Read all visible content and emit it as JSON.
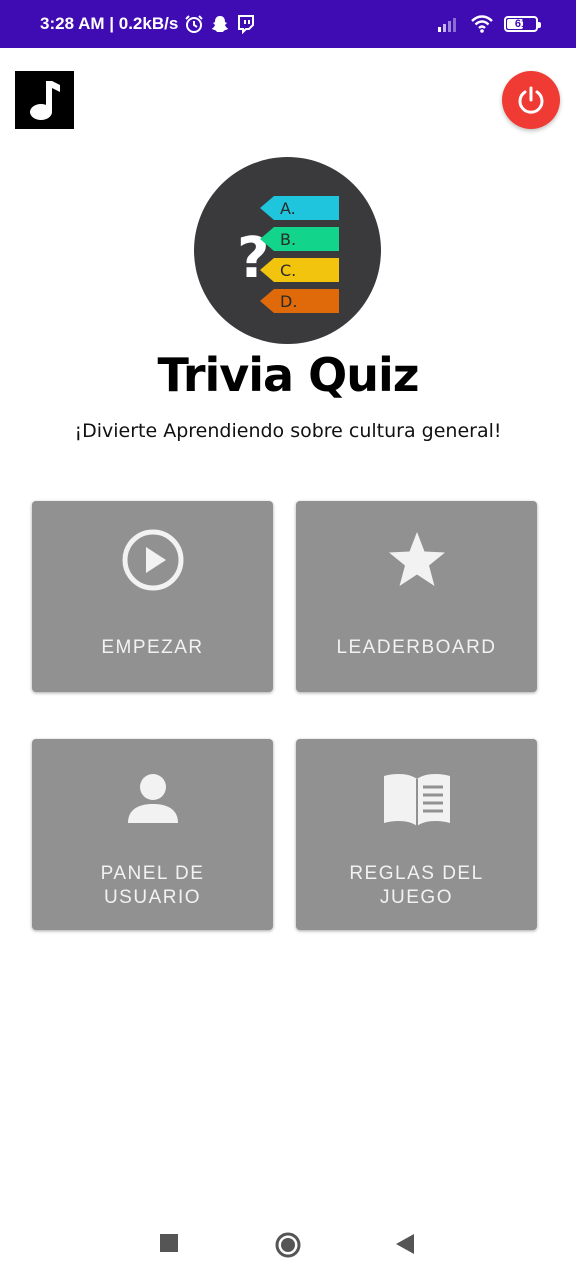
{
  "status_bar": {
    "time_speed": "3:28 AM | 0.2kB/s",
    "battery": "61",
    "battery_level": 0.61,
    "bg_color": "#3f0bb3"
  },
  "header": {
    "music_icon": "music-note-icon",
    "power_icon": "power-icon",
    "power_color": "#ef3b33"
  },
  "logo": {
    "options": [
      "A.",
      "B.",
      "C.",
      "D."
    ],
    "option_colors": [
      "#1fc5dc",
      "#12d48a",
      "#f2c40d",
      "#e06a0a"
    ],
    "question_mark": "?"
  },
  "title": "Trivia Quiz",
  "subtitle": "¡Divierte Aprendiendo sobre cultura general!",
  "menu": {
    "start": {
      "label": "EMPEZAR",
      "icon": "play-circle-icon"
    },
    "leaderboard": {
      "label": "LEADERBOARD",
      "icon": "star-icon"
    },
    "user_panel": {
      "label": "PANEL DE\nUSUARIO",
      "icon": "person-icon"
    },
    "rules": {
      "label": "REGLAS DEL\nJUEGO",
      "icon": "book-icon"
    }
  },
  "nav": {
    "recents_icon": "square-icon",
    "home_icon": "circle-icon",
    "back_icon": "triangle-back-icon"
  }
}
